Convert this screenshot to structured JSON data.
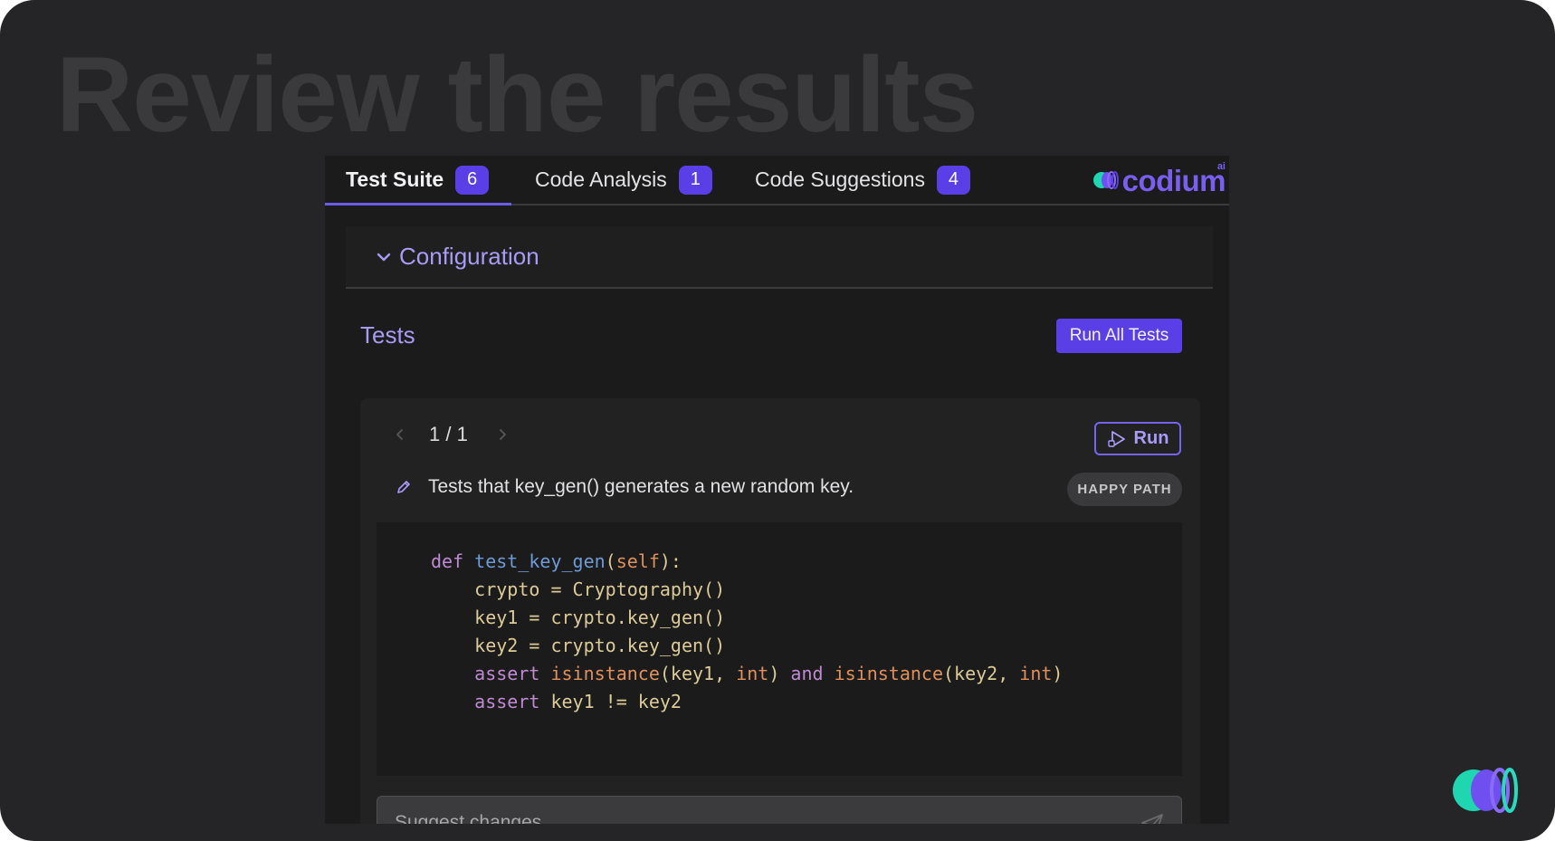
{
  "hero": {
    "title": "Review the results"
  },
  "tabs": [
    {
      "label": "Test Suite",
      "count": "6",
      "active": true
    },
    {
      "label": "Code Analysis",
      "count": "1",
      "active": false
    },
    {
      "label": "Code Suggestions",
      "count": "4",
      "active": false
    }
  ],
  "brand": {
    "name": "codium",
    "suffix": "ai"
  },
  "configuration": {
    "label": "Configuration"
  },
  "tests": {
    "title": "Tests",
    "run_all_label": "Run All Tests",
    "pager": "1 / 1",
    "run_label": "Run",
    "description": "Tests that key_gen() generates a new random key.",
    "tag": "HAPPY PATH"
  },
  "code": {
    "lines": [
      "def test_key_gen(self):",
      "    crypto = Cryptography()",
      "    key1 = crypto.key_gen()",
      "    key2 = crypto.key_gen()",
      "    assert isinstance(key1, int) and isinstance(key2, int)",
      "    assert key1 != key2"
    ]
  },
  "suggest": {
    "placeholder": "Suggest changes"
  },
  "colors": {
    "accent": "#5b3fe6",
    "accent_text": "#a79bf5",
    "frame_bg": "#252527",
    "panel_bg": "#1b1b1c",
    "logo_teal": "#1fd6b0",
    "logo_purple": "#7a5ef0"
  },
  "icons": [
    "chevron-down-icon",
    "chevron-left-icon",
    "chevron-right-icon",
    "run-icon",
    "pencil-icon",
    "send-icon",
    "codium-logo-icon"
  ]
}
